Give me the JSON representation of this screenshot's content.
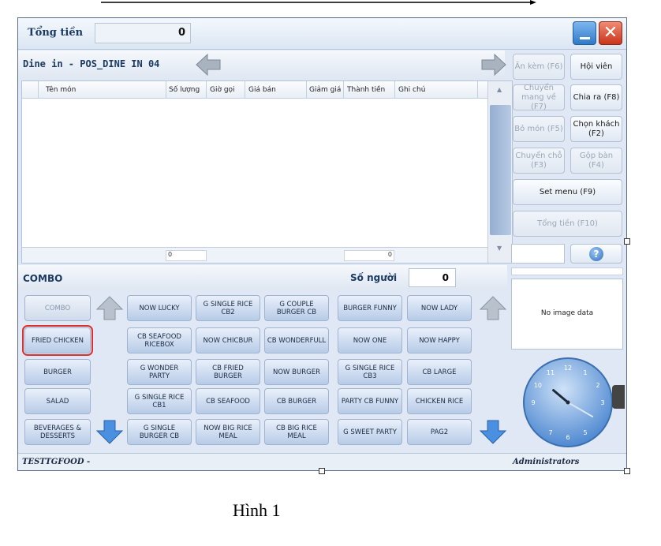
{
  "header": {
    "total_label": "Tổng tiền",
    "total_value": "0"
  },
  "order": {
    "title": "Dine in - POS_DINE IN 04",
    "columns": [
      "Tên món",
      "Số lượng",
      "Giờ gọi",
      "Giá bán",
      "Giảm giá",
      "Thành tiền",
      "Ghi chú"
    ],
    "qty_total": "0",
    "amount_total": "0"
  },
  "actions": {
    "extra": "Ăn kèm (F6)",
    "member": "Hội viên",
    "move_takeaway": "Chuyển mang về (F7)",
    "split_bill": "Chia ra (F8)",
    "remove_item": "Bỏ món (F5)",
    "select_customer": "Chọn khách (F2)",
    "move_table": "Chuyển chỗ (F3)",
    "merge_table": "Gộp bàn (F4)",
    "set_menu": "Set menu (F9)",
    "total": "Tổng tiền (F10)",
    "help": "?"
  },
  "combo": {
    "title": "COMBO",
    "people_label": "Số người",
    "people_value": "0",
    "categories": [
      "COMBO",
      "FRIED CHICKEN",
      "BURGER",
      "SALAD",
      "BEVERAGES & DESSERTS"
    ],
    "items": [
      [
        "NOW LUCKY",
        "G SINGLE RICE CB2",
        "G COUPLE BURGER CB",
        "BURGER FUNNY",
        "NOW LADY"
      ],
      [
        "CB SEAFOOD RICEBOX",
        "NOW CHICBUR",
        "CB WONDERFULL",
        "NOW ONE",
        "NOW HAPPY"
      ],
      [
        "G WONDER PARTY",
        "CB FRIED BURGER",
        "NOW BURGER",
        "G SINGLE RICE CB3",
        "CB LARGE"
      ],
      [
        "G SINGLE RICE CB1",
        "CB SEAFOOD",
        "CB BURGER",
        "PARTY CB FUNNY",
        "CHICKEN RICE"
      ],
      [
        "G SINGLE BURGER CB",
        "NOW BIG RICE MEAL",
        "CB BIG RICE MEAL",
        "G SWEET PARTY",
        "PAG2"
      ]
    ]
  },
  "image_panel": {
    "text": "No image data"
  },
  "clock": {
    "numbers": [
      "12",
      "1",
      "2",
      "3",
      "5",
      "6",
      "7",
      "9",
      "10",
      "11"
    ],
    "hour": 10,
    "minute": 20
  },
  "status": {
    "left": "TESTTGFOOD -",
    "right": "Administrators"
  },
  "caption": "Hình 1",
  "colors": {
    "selected_outline": "#d9312e",
    "header_text": "#1b3a63"
  }
}
